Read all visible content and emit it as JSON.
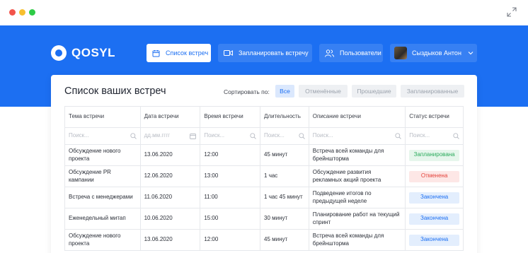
{
  "window": {
    "expand_icon": "expand-icon"
  },
  "brand": {
    "name": "QOSYL",
    "color": "#1c6ff2"
  },
  "nav": {
    "list_label": "Список встреч",
    "plan_label": "Запланировать встречу",
    "users_label": "Пользователи",
    "user_name": "Сыздыков Антон"
  },
  "card": {
    "title": "Список ваших встреч",
    "sort_label": "Сортировать по:",
    "sort_options": [
      "Все",
      "Отменённые",
      "Прошедшие",
      "Запланированные"
    ],
    "sort_selected": "Все"
  },
  "table": {
    "headers": [
      "Тема встречи",
      "Дата встречи",
      "Время встречи",
      "Длительность",
      "Описание встречи",
      "Статус встречи"
    ],
    "filters": [
      "Поиск...",
      "дд.мм.гггг",
      "Поиск...",
      "Поиск...",
      "Поиск...",
      "Поиск..."
    ],
    "rows": [
      {
        "topic": "Обсуждение нового проекта",
        "date": "13.06.2020",
        "time": "12:00",
        "duration": "45 минут",
        "description": "Встреча всей команды для брейншторма",
        "status": "Запланирована",
        "status_type": "planned"
      },
      {
        "topic": "Обсуждение PR кампании",
        "date": "12.06.2020",
        "time": "13:00",
        "duration": "1 час",
        "description": "Обсуждение развития рекламных акций проекта",
        "status": "Отменена",
        "status_type": "cancelled"
      },
      {
        "topic": "Встреча с менеджерами",
        "date": "11.06.2020",
        "time": "11:00",
        "duration": "1 час 45 минут",
        "description": "Подведение итогов по предыдущей неделе",
        "status": "Закончена",
        "status_type": "finished"
      },
      {
        "topic": "Еженедельный митап",
        "date": "10.06.2020",
        "time": "15:00",
        "duration": "30 минут",
        "description": "Планирование работ на текущий спринт",
        "status": "Закончена",
        "status_type": "finished"
      },
      {
        "topic": "Обсуждение нового проекта",
        "date": "13.06.2020",
        "time": "12:00",
        "duration": "45 минут",
        "description": "Встреча всей команды для брейншторма",
        "status": "Закончена",
        "status_type": "finished"
      }
    ]
  },
  "status_colors": {
    "planned": "#2bab5c",
    "cancelled": "#e4433b",
    "finished": "#1c6ff2"
  }
}
